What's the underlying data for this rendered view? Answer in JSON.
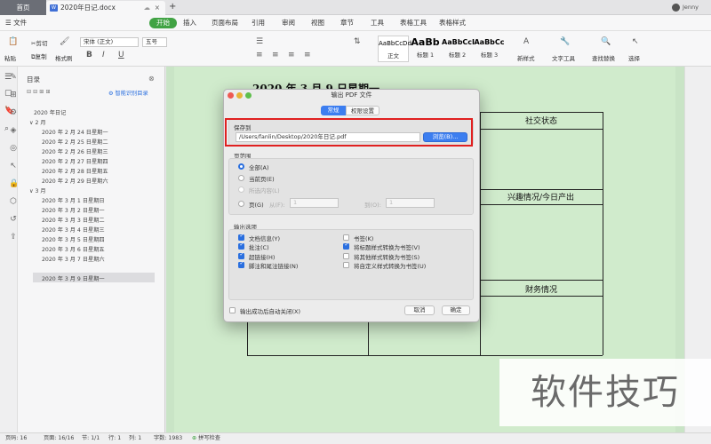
{
  "titlebar": {
    "home": "首页",
    "doc_tab": "2020年日记.docx",
    "doc_icon": "W",
    "new_tab": "+",
    "user": "Jenny"
  },
  "menu": {
    "file": "文件",
    "items": [
      "开始",
      "插入",
      "页面布局",
      "引用",
      "审阅",
      "视图",
      "章节",
      "工具",
      "表格工具",
      "表格样式"
    ]
  },
  "toolbar": {
    "paste": "粘贴",
    "cut": "剪切",
    "copy": "复制",
    "format_painter": "格式刷",
    "font": "宋体 (正文)",
    "size": "五号",
    "bold": "B",
    "italic": "I",
    "underline": "U",
    "styles": [
      {
        "preview": "AaBbCcDd",
        "name": "正文"
      },
      {
        "preview": "AaBb",
        "name": "标题 1"
      },
      {
        "preview": "AaBbCcI",
        "name": "标题 2"
      },
      {
        "preview": "AaBbCc",
        "name": "标题 3"
      }
    ],
    "new_style": "新样式",
    "text_tools": "文字工具",
    "find_replace": "查找替换",
    "select": "选择"
  },
  "nav": {
    "title": "目录",
    "smart": "智能识别目录",
    "root": "2020 年日记",
    "groups": [
      {
        "label": "2 月",
        "items": [
          "2020 年 2 月 24 日星期一",
          "2020 年 2 月 25 日星期二",
          "2020 年 2 月 26 日星期三",
          "2020 年 2 月 27 日星期四",
          "2020 年 2 月 28 日星期五",
          "2020 年 2 月 29 日星期六"
        ]
      },
      {
        "label": "3 月",
        "items": [
          "2020 年 3 月 1 日星期日",
          "2020 年 3 月 2 日星期一",
          "2020 年 3 月 3 日星期二",
          "2020 年 3 月 4 日星期三",
          "2020 年 3 月 5 日星期四",
          "2020 年 3 月 6 日星期五",
          "2020 年 3 月 7 日星期六",
          "2020 年 3 月 9 日星期一"
        ]
      }
    ]
  },
  "document": {
    "heading": "2020 年 3 月 9 日星期一",
    "cells": [
      "社交状态",
      "兴趣情况/今日产出",
      "财务情况"
    ]
  },
  "dialog": {
    "title": "输出 PDF 文件",
    "tabs": [
      "常规",
      "权限设置"
    ],
    "save_to_label": "保存到",
    "path": "/Users/fanlin/Desktop/2020年日记.pdf",
    "browse": "浏览(B)...",
    "range_label": "页范围",
    "range_options": [
      "全部(A)",
      "当前页(E)",
      "所选内容(L)",
      "页(G)"
    ],
    "from_label": "从(F):",
    "from_value": "1",
    "to_label": "到(O):",
    "to_value": "1",
    "output_label": "输出选项",
    "options_left": [
      {
        "label": "文档信息(Y)",
        "checked": true
      },
      {
        "label": "批注(C)",
        "checked": true
      },
      {
        "label": "超链接(H)",
        "checked": true
      },
      {
        "label": "脚注和尾注链接(N)",
        "checked": true
      }
    ],
    "options_right": [
      {
        "label": "书签(K)",
        "checked": false
      },
      {
        "label": "将标题样式转换为书签(V)",
        "checked": true
      },
      {
        "label": "将其他样式转换为书签(S)",
        "checked": false
      },
      {
        "label": "将自定义样式转换为书签(U)",
        "checked": false
      }
    ],
    "auto_close": "输出成功后自动关闭(X)",
    "cancel": "取消",
    "ok": "确定"
  },
  "status": {
    "page": "页码: 16",
    "pages": "页面: 16/16",
    "section": "节: 1/1",
    "row": "行: 1",
    "col": "列: 1",
    "words": "字数: 1983",
    "spell": "拼写检查"
  },
  "watermark": "软件技巧",
  "colors": {
    "accent": "#41a344",
    "dialog_button": "#3c7ef0",
    "highlight": "#e02020",
    "doc_bg": "#c9e4c6"
  }
}
